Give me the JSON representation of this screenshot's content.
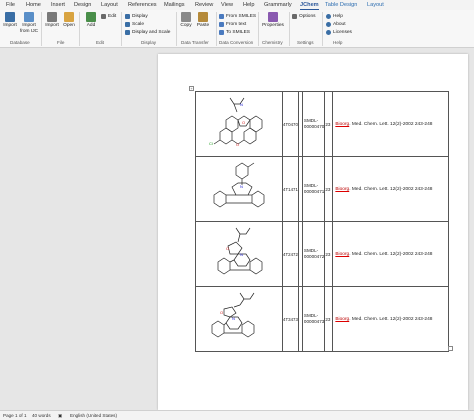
{
  "tabs": [
    "File",
    "Home",
    "Insert",
    "Design",
    "Layout",
    "References",
    "Mailings",
    "Review",
    "View",
    "Help",
    "Grammarly",
    "JChem",
    "Table Design",
    "Layout"
  ],
  "active_tab": "JChem",
  "ribbon": {
    "database": {
      "import": "Import",
      "import_ijc": "Import from IJC",
      "label": "Database"
    },
    "file": {
      "import": "Import",
      "open": "Open",
      "label": "File"
    },
    "edit": {
      "add": "Add",
      "edit": "Edit",
      "label": "Edit"
    },
    "display": {
      "display": "Display",
      "scale": "Scale",
      "display_scale": "Display and Scale",
      "label": "Display"
    },
    "transfer": {
      "copy": "Copy",
      "paste": "Paste",
      "label": "Data Transfer"
    },
    "conversion": {
      "from_smiles": "From SMILES",
      "from_text": "From text",
      "to_smiles": "To SMILES",
      "label": "Data Conversion"
    },
    "chemistry": {
      "properties": "Properties",
      "label": "Chemistry"
    },
    "settings": {
      "options": "Options",
      "label": "Settings"
    },
    "help_group": {
      "help": "Help",
      "about": "About",
      "licenses": "Licenses",
      "label": "Help"
    }
  },
  "colors": {
    "accent": "#2b579a",
    "jchem_tab": "#2b6cb0",
    "chlorine": "#1a9a1a",
    "oxygen": "#d42020",
    "nitrogen": "#2020d4"
  },
  "rows": [
    {
      "id": "4T0470",
      "code_line1": "SMDL-",
      "code_line2": "00000470",
      "n": "23",
      "ref_prefix": "Bioorg",
      "ref_rest": ". Med. Chem. Lett. 12(2)-2002 243-248"
    },
    {
      "id": "4T1471",
      "code_line1": "SMDL-",
      "code_line2": "00000471",
      "n": "23",
      "ref_prefix": "Bioorg",
      "ref_rest": ". Med. Chem. Lett. 12(2)-2002 243-248"
    },
    {
      "id": "4T2472",
      "code_line1": "SMDL-",
      "code_line2": "00000472",
      "n": "23",
      "ref_prefix": "Bioorg",
      "ref_rest": ". Med. Chem. Lett. 12(2)-2002 243-248"
    },
    {
      "id": "4T3473",
      "code_line1": "SMDL-",
      "code_line2": "00000473",
      "n": "23",
      "ref_prefix": "Bioorg",
      "ref_rest": ". Med. Chem. Lett. 12(2)-2002 243-248"
    }
  ],
  "status": {
    "page": "Page 1 of 1",
    "words": "40 words",
    "language": "English (United States)"
  }
}
